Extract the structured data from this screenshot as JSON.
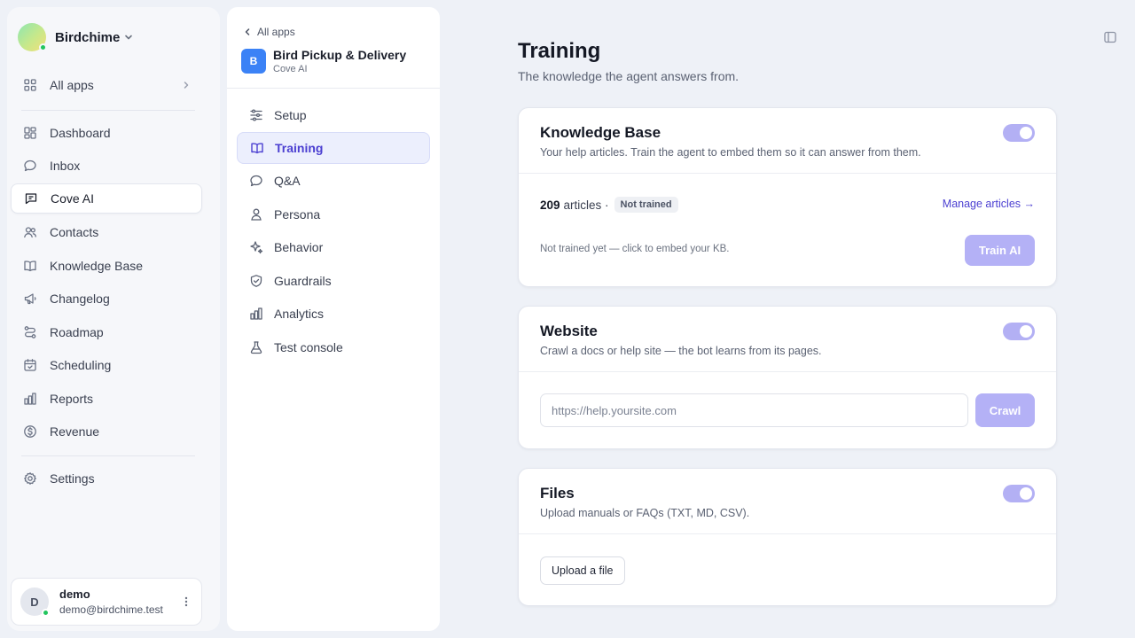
{
  "workspace": {
    "name": "Birdchime"
  },
  "sidebar": {
    "all_apps": "All apps",
    "items": [
      {
        "label": "Dashboard",
        "icon": "dashboard-icon"
      },
      {
        "label": "Inbox",
        "icon": "chat-icon"
      },
      {
        "label": "Cove AI",
        "icon": "message-square-icon"
      },
      {
        "label": "Contacts",
        "icon": "users-icon"
      },
      {
        "label": "Knowledge Base",
        "icon": "book-icon"
      },
      {
        "label": "Changelog",
        "icon": "megaphone-icon"
      },
      {
        "label": "Roadmap",
        "icon": "route-icon"
      },
      {
        "label": "Scheduling",
        "icon": "calendar-icon"
      },
      {
        "label": "Reports",
        "icon": "bar-chart-icon"
      },
      {
        "label": "Revenue",
        "icon": "dollar-icon"
      }
    ],
    "settings": "Settings",
    "active": "Cove AI"
  },
  "user": {
    "initial": "D",
    "name": "demo",
    "email": "demo@birdchime.test"
  },
  "app": {
    "back_label": "All apps",
    "badge": "B",
    "name": "Bird Pickup & Delivery",
    "sub": "Cove AI",
    "nav": [
      {
        "label": "Setup",
        "icon": "sliders-icon"
      },
      {
        "label": "Training",
        "icon": "book-open-icon"
      },
      {
        "label": "Q&A",
        "icon": "chat-icon"
      },
      {
        "label": "Persona",
        "icon": "user-icon"
      },
      {
        "label": "Behavior",
        "icon": "sparkles-icon"
      },
      {
        "label": "Guardrails",
        "icon": "shield-icon"
      },
      {
        "label": "Analytics",
        "icon": "bar-chart-icon"
      },
      {
        "label": "Test console",
        "icon": "flask-icon"
      }
    ],
    "active": "Training"
  },
  "page": {
    "title": "Training",
    "subtitle": "The knowledge the agent answers from."
  },
  "kb_card": {
    "title": "Knowledge Base",
    "desc": "Your help articles. Train the agent to embed them so it can answer from them.",
    "enabled": true,
    "count": "209",
    "count_suffix": "articles ·",
    "status": "Not trained",
    "manage": "Manage articles →",
    "note": "Not trained yet — click to embed your KB.",
    "button": "Train AI"
  },
  "website_card": {
    "title": "Website",
    "desc": "Crawl a docs or help site — the bot learns from its pages.",
    "enabled": true,
    "placeholder": "https://help.yoursite.com",
    "value": "",
    "button": "Crawl"
  },
  "files_card": {
    "title": "Files",
    "desc": "Upload manuals or FAQs (TXT, MD, CSV).",
    "enabled": true,
    "button": "Upload a file"
  },
  "colors": {
    "accent": "#4b3fd1",
    "accent_disabled": "#b4b1f6",
    "app_badge": "#3b82f6",
    "online": "#22c55e"
  }
}
